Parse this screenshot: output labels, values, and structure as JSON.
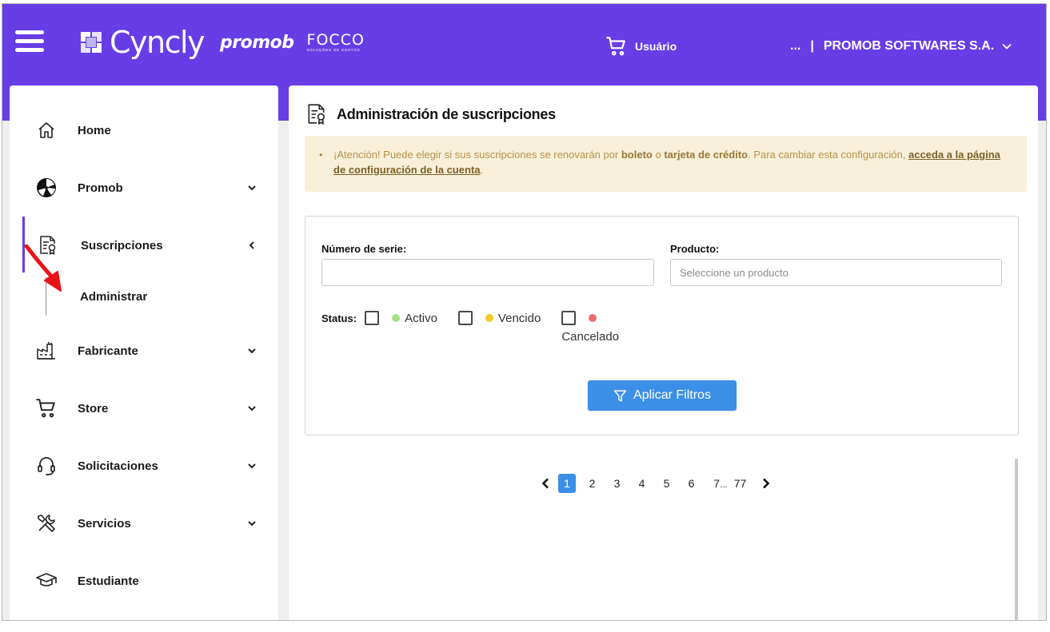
{
  "header": {
    "brand_cyncly": "Cyncly",
    "brand_promob": "promob",
    "brand_focco": "FOCCO",
    "brand_focco_sub": "SOLUÇÕES DE GESTÃO",
    "cart_user_label": "Usuário",
    "company_ellipsis": "...",
    "company_separator": "|",
    "company_name": "PROMOB SOFTWARES S.A."
  },
  "sidebar": {
    "items": [
      {
        "label": "Home",
        "icon": "home-icon"
      },
      {
        "label": "Promob",
        "icon": "promob-icon"
      },
      {
        "label": "Suscripciones",
        "icon": "subscription-icon"
      },
      {
        "label": "Fabricante",
        "icon": "factory-icon"
      },
      {
        "label": "Store",
        "icon": "cart-icon"
      },
      {
        "label": "Solicitaciones",
        "icon": "headset-icon"
      },
      {
        "label": "Servicios",
        "icon": "tools-icon"
      },
      {
        "label": "Estudiante",
        "icon": "graduation-icon"
      }
    ],
    "sub_item": "Administrar"
  },
  "main": {
    "title": "Administración de suscripciones",
    "notice": {
      "part1": "¡Atención! Puede elegir si sus suscripciones se renovarán por ",
      "bold1": "boleto",
      "part2": " o ",
      "bold2": "tarjeta de crédito",
      "part3": ". Para cambiar esta configuración, ",
      "link": "acceda a la página de configuración de la cuenta",
      "part4": "."
    },
    "filters": {
      "serial_label": "Número de serie:",
      "serial_value": "",
      "product_label": "Producto:",
      "product_placeholder": "Seleccione un producto",
      "status_label": "Status:",
      "status_options": [
        {
          "label": "Activo",
          "color": "#a6e08a"
        },
        {
          "label": "Vencido",
          "color": "#f6c92b"
        },
        {
          "label": "Cancelado",
          "color": "#ea6c6c"
        }
      ],
      "apply_label": "Aplicar Filtros"
    },
    "pagination": {
      "pages": [
        "1",
        "2",
        "3",
        "4",
        "5",
        "6",
        "7"
      ],
      "ellipsis": "...",
      "last": "77",
      "current": "1"
    }
  },
  "colors": {
    "brand_purple": "#673de6",
    "accent_blue": "#3b8fe6",
    "notice_bg": "#f8f0d9"
  }
}
